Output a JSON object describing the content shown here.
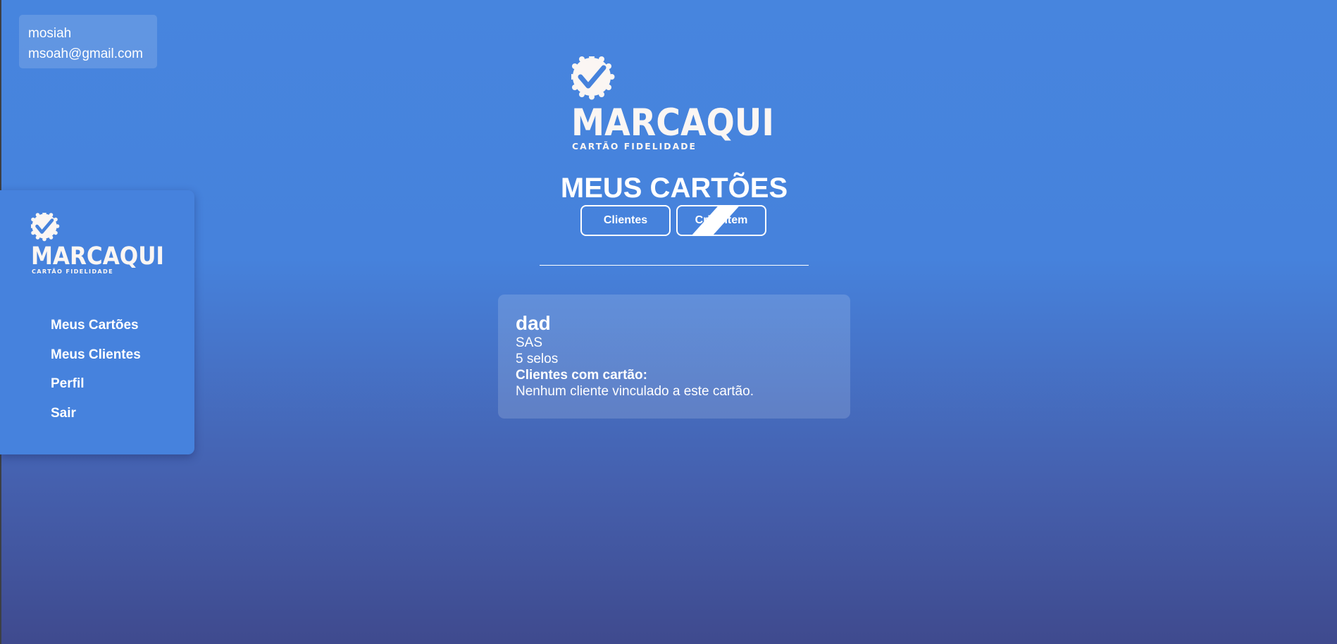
{
  "user": {
    "name": "mosiah",
    "email": "msoah@gmail.com"
  },
  "brand": {
    "name": "MARCAQUI",
    "tagline": "CARTÃO FIDELIDADE"
  },
  "sidebar": {
    "items": [
      {
        "label": "Meus Cartões"
      },
      {
        "label": "Meus Clientes"
      },
      {
        "label": "Perfil"
      },
      {
        "label": "Sair"
      }
    ]
  },
  "main": {
    "title": "MEUS CARTÕES",
    "tabs": [
      {
        "label": "Clientes"
      },
      {
        "label": "Criar Item"
      }
    ]
  },
  "card": {
    "title": "dad",
    "subtitle": "SAS",
    "stamps": "5 selos",
    "clients_heading": "Clientes com cartão:",
    "clients_empty": "Nenhum cliente vinculado a este cartão."
  },
  "colors": {
    "background_top": "#4785de",
    "background_bottom": "#3f4a8e",
    "sidebar": "#4682dd",
    "text": "#ffffff"
  }
}
